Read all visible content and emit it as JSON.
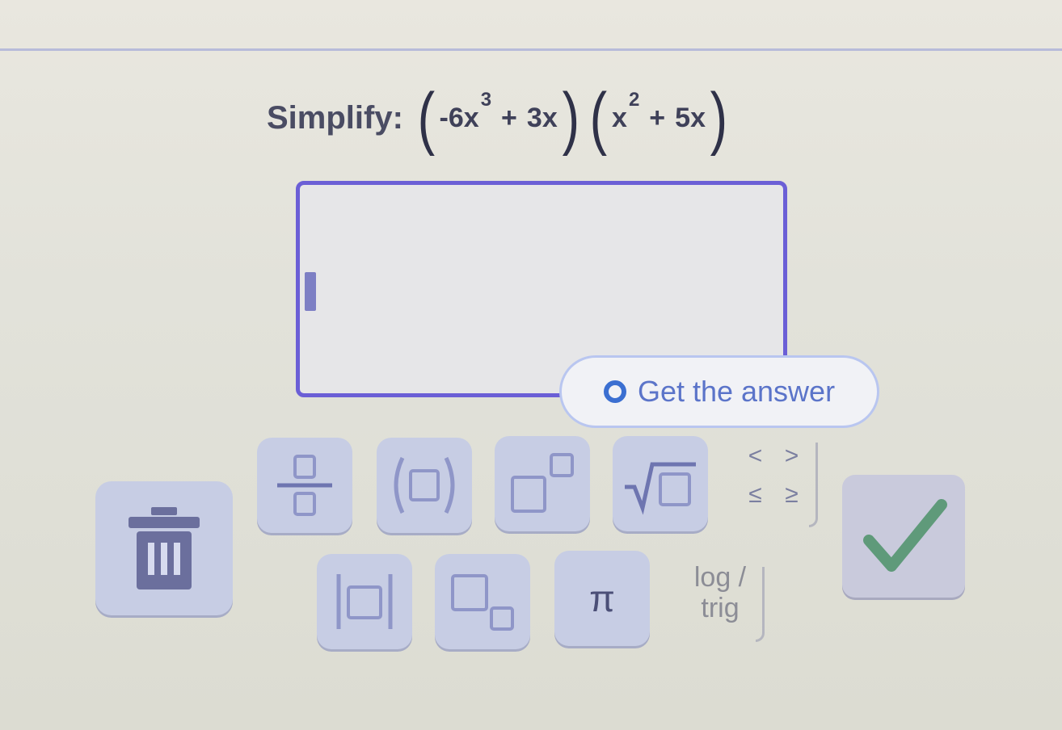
{
  "question": {
    "label": "Simplify:",
    "factor1": {
      "term1": "-6x",
      "term1_exp": "3",
      "operator": "+",
      "term2": "3x"
    },
    "factor2": {
      "term1": "x",
      "term1_exp": "2",
      "operator": "+",
      "term2": "5x"
    }
  },
  "answer_input": {
    "value": ""
  },
  "get_answer_button": {
    "label": "Get the answer"
  },
  "keypad": {
    "fraction_key": "fraction-icon",
    "parentheses_key": "parentheses-icon",
    "exponent_key": "exponent-icon",
    "sqrt_key": "sqrt-icon",
    "comparison": {
      "lt": "<",
      "gt": ">",
      "le": "≤",
      "ge": "≥"
    },
    "absolute_key": "absolute-value-icon",
    "subscript_key": "subscript-icon",
    "pi_label": "π",
    "log_trig": {
      "line1": "log /",
      "line2": "trig"
    },
    "clear_key": "trash-icon",
    "submit_key": "checkmark-icon"
  },
  "colors": {
    "accent": "#6b5fd6",
    "key_bg": "#c7cde4",
    "check_green": "#5f9a7a",
    "link_blue": "#5b74c9"
  }
}
